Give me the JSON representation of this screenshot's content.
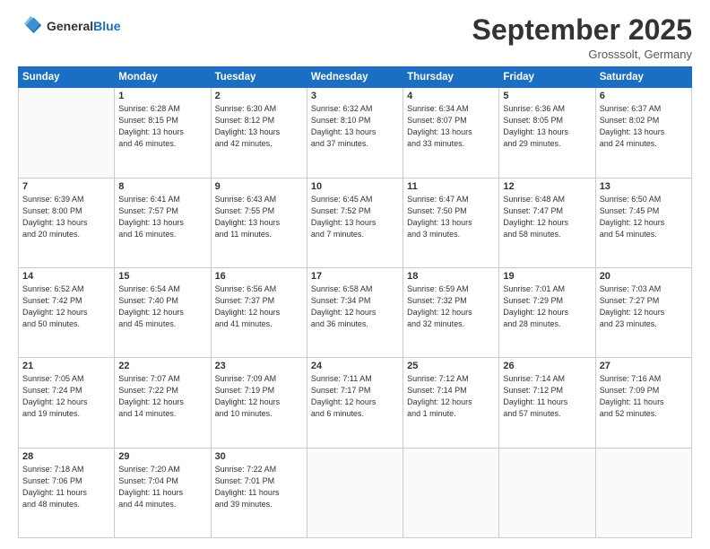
{
  "header": {
    "logo_line1": "General",
    "logo_line2": "Blue",
    "month": "September 2025",
    "location": "Grosssolt, Germany"
  },
  "days_of_week": [
    "Sunday",
    "Monday",
    "Tuesday",
    "Wednesday",
    "Thursday",
    "Friday",
    "Saturday"
  ],
  "weeks": [
    [
      {
        "day": "",
        "info": ""
      },
      {
        "day": "1",
        "info": "Sunrise: 6:28 AM\nSunset: 8:15 PM\nDaylight: 13 hours\nand 46 minutes."
      },
      {
        "day": "2",
        "info": "Sunrise: 6:30 AM\nSunset: 8:12 PM\nDaylight: 13 hours\nand 42 minutes."
      },
      {
        "day": "3",
        "info": "Sunrise: 6:32 AM\nSunset: 8:10 PM\nDaylight: 13 hours\nand 37 minutes."
      },
      {
        "day": "4",
        "info": "Sunrise: 6:34 AM\nSunset: 8:07 PM\nDaylight: 13 hours\nand 33 minutes."
      },
      {
        "day": "5",
        "info": "Sunrise: 6:36 AM\nSunset: 8:05 PM\nDaylight: 13 hours\nand 29 minutes."
      },
      {
        "day": "6",
        "info": "Sunrise: 6:37 AM\nSunset: 8:02 PM\nDaylight: 13 hours\nand 24 minutes."
      }
    ],
    [
      {
        "day": "7",
        "info": "Sunrise: 6:39 AM\nSunset: 8:00 PM\nDaylight: 13 hours\nand 20 minutes."
      },
      {
        "day": "8",
        "info": "Sunrise: 6:41 AM\nSunset: 7:57 PM\nDaylight: 13 hours\nand 16 minutes."
      },
      {
        "day": "9",
        "info": "Sunrise: 6:43 AM\nSunset: 7:55 PM\nDaylight: 13 hours\nand 11 minutes."
      },
      {
        "day": "10",
        "info": "Sunrise: 6:45 AM\nSunset: 7:52 PM\nDaylight: 13 hours\nand 7 minutes."
      },
      {
        "day": "11",
        "info": "Sunrise: 6:47 AM\nSunset: 7:50 PM\nDaylight: 13 hours\nand 3 minutes."
      },
      {
        "day": "12",
        "info": "Sunrise: 6:48 AM\nSunset: 7:47 PM\nDaylight: 12 hours\nand 58 minutes."
      },
      {
        "day": "13",
        "info": "Sunrise: 6:50 AM\nSunset: 7:45 PM\nDaylight: 12 hours\nand 54 minutes."
      }
    ],
    [
      {
        "day": "14",
        "info": "Sunrise: 6:52 AM\nSunset: 7:42 PM\nDaylight: 12 hours\nand 50 minutes."
      },
      {
        "day": "15",
        "info": "Sunrise: 6:54 AM\nSunset: 7:40 PM\nDaylight: 12 hours\nand 45 minutes."
      },
      {
        "day": "16",
        "info": "Sunrise: 6:56 AM\nSunset: 7:37 PM\nDaylight: 12 hours\nand 41 minutes."
      },
      {
        "day": "17",
        "info": "Sunrise: 6:58 AM\nSunset: 7:34 PM\nDaylight: 12 hours\nand 36 minutes."
      },
      {
        "day": "18",
        "info": "Sunrise: 6:59 AM\nSunset: 7:32 PM\nDaylight: 12 hours\nand 32 minutes."
      },
      {
        "day": "19",
        "info": "Sunrise: 7:01 AM\nSunset: 7:29 PM\nDaylight: 12 hours\nand 28 minutes."
      },
      {
        "day": "20",
        "info": "Sunrise: 7:03 AM\nSunset: 7:27 PM\nDaylight: 12 hours\nand 23 minutes."
      }
    ],
    [
      {
        "day": "21",
        "info": "Sunrise: 7:05 AM\nSunset: 7:24 PM\nDaylight: 12 hours\nand 19 minutes."
      },
      {
        "day": "22",
        "info": "Sunrise: 7:07 AM\nSunset: 7:22 PM\nDaylight: 12 hours\nand 14 minutes."
      },
      {
        "day": "23",
        "info": "Sunrise: 7:09 AM\nSunset: 7:19 PM\nDaylight: 12 hours\nand 10 minutes."
      },
      {
        "day": "24",
        "info": "Sunrise: 7:11 AM\nSunset: 7:17 PM\nDaylight: 12 hours\nand 6 minutes."
      },
      {
        "day": "25",
        "info": "Sunrise: 7:12 AM\nSunset: 7:14 PM\nDaylight: 12 hours\nand 1 minute."
      },
      {
        "day": "26",
        "info": "Sunrise: 7:14 AM\nSunset: 7:12 PM\nDaylight: 11 hours\nand 57 minutes."
      },
      {
        "day": "27",
        "info": "Sunrise: 7:16 AM\nSunset: 7:09 PM\nDaylight: 11 hours\nand 52 minutes."
      }
    ],
    [
      {
        "day": "28",
        "info": "Sunrise: 7:18 AM\nSunset: 7:06 PM\nDaylight: 11 hours\nand 48 minutes."
      },
      {
        "day": "29",
        "info": "Sunrise: 7:20 AM\nSunset: 7:04 PM\nDaylight: 11 hours\nand 44 minutes."
      },
      {
        "day": "30",
        "info": "Sunrise: 7:22 AM\nSunset: 7:01 PM\nDaylight: 11 hours\nand 39 minutes."
      },
      {
        "day": "",
        "info": ""
      },
      {
        "day": "",
        "info": ""
      },
      {
        "day": "",
        "info": ""
      },
      {
        "day": "",
        "info": ""
      }
    ]
  ]
}
